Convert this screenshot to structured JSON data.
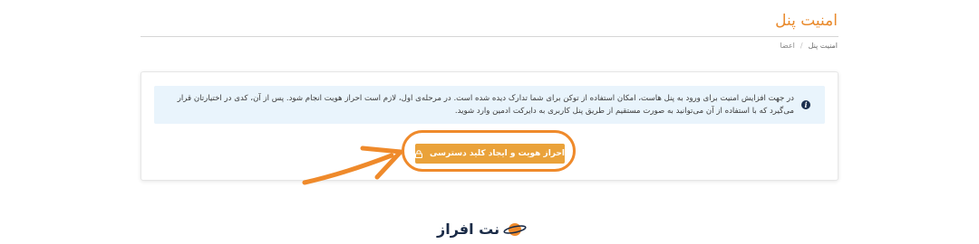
{
  "page": {
    "title": "امنیت پنل"
  },
  "breadcrumb": {
    "items": [
      "اعضا",
      "امنیت پنل"
    ],
    "separator": "/"
  },
  "alert": {
    "icon": "info-icon",
    "text": "در جهت افزایش امنیت برای ورود به پنل هاست، امکان استفاده از توکن برای شما تدارک دیده شده است. در مرحله‌ی اول، لازم است احراز هویت انجام شود. پس از آن، کدی در اختیارتان قرار می‌گیرد که با استفاده از آن می‌توانید به صورت مستقیم از طریق پنل کاربری به دایرکت ادمین وارد شوید."
  },
  "cta": {
    "label": "احراز هویت و ایجاد کلید دسترسی",
    "icon": "lock-icon"
  },
  "footer": {
    "logo_text": "نت افراز",
    "logo_icon": "planet-logo-icon"
  },
  "colors": {
    "accent": "#e98a2c",
    "button": "#eaa23a",
    "annotation": "#ef8a2b",
    "alert_bg": "#e9f4fc",
    "brand_dark": "#1a2b47"
  }
}
